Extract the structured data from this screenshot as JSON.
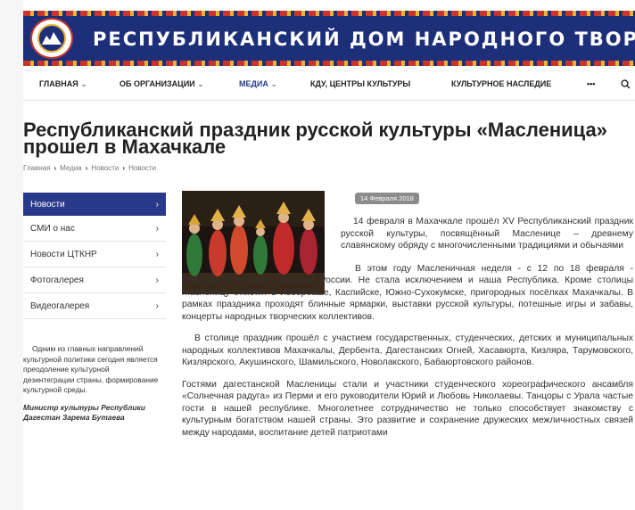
{
  "header": {
    "banner_title": "РЕСПУБЛИКАНСКИЙ ДОМ НАРОДНОГО ТВОРЧЕСТВА",
    "colors": {
      "banner": "#1e2f7a",
      "ornament_red": "#c8352e",
      "ornament_gold": "#e8b23a",
      "accent": "#2a3a8a"
    }
  },
  "nav": {
    "items": [
      {
        "label": "ГЛАВНАЯ",
        "has_dropdown": true
      },
      {
        "label": "ОБ ОРГАНИЗАЦИИ",
        "has_dropdown": true
      },
      {
        "label": "МЕДИА",
        "has_dropdown": true,
        "active": true
      },
      {
        "label": "КДУ, ЦЕНТРЫ КУЛЬТУРЫ",
        "has_dropdown": false
      },
      {
        "label": "КУЛЬТУРНОЕ НАСЛЕДИЕ",
        "has_dropdown": false
      }
    ],
    "more_label": "•••",
    "search_icon": "search-icon"
  },
  "page": {
    "title": "Республиканский праздник русской культуры «Масленица» прошел в Махачкале",
    "breadcrumb": [
      "Главная",
      "Медиа",
      "Новости",
      "Новости"
    ]
  },
  "sidebar": {
    "items": [
      {
        "label": "Новости",
        "active": true
      },
      {
        "label": "СМИ о нас"
      },
      {
        "label": "Новости ЦТКНР"
      },
      {
        "label": "Фотогалерея"
      },
      {
        "label": "Видеогалерея"
      }
    ],
    "quote_text": "Одним из главных направлений культурной политики сегодня является преодоление культурной дезинтеграции страны, формирование культурной среды.",
    "quote_author": "Министр культуры Республики Дагестан Зарема Бутаева"
  },
  "article": {
    "date": "14 Февраля 2018",
    "paragraphs": [
      "14 февраля в Махачкале прошёл XV Республиканский праздник русской культуры, посвящённый Масленице – древнему славянскому обряду с многочисленными традициями и обычаями",
      "В этом году Масленичная неделя - с 12 по 18 февраля - отмечается во всех регионах России. Не стала исключением и наша Республика. Кроме столицы Масленицу отметят в Избербаше, Каспийске, Южно-Сухокумске, пригородных посёлках Махачкалы. В рамках праздника проходят блинные ярмарки, выставки русской культуры, потешные игры и забавы, концерты народных творческих коллективов.",
      "В столице праздник прошёл с участием государственных, студенческих, детских и муниципальных народных коллективов Махачкалы, Дербента, Дагестанских Огней, Хасавюрта, Кизляра, Тарумовского, Кизлярского, Акушинского, Шамильского, Новолакского, Бабаюртовского районов.",
      "Гостями дагестанской Масленицы стали и участники студенческого хореографического ансамбля «Солнечная радуга» из Перми и его руководители Юрий и Любовь Николаевы. Танцоры с Урала частые гости в нашей республике. Многолетнее сотрудничество не только способствует знакомству с культурным богатством нашей страны. Это развитие и сохранение дружеских межличностных связей между народами, воспитание детей патриотами"
    ]
  }
}
